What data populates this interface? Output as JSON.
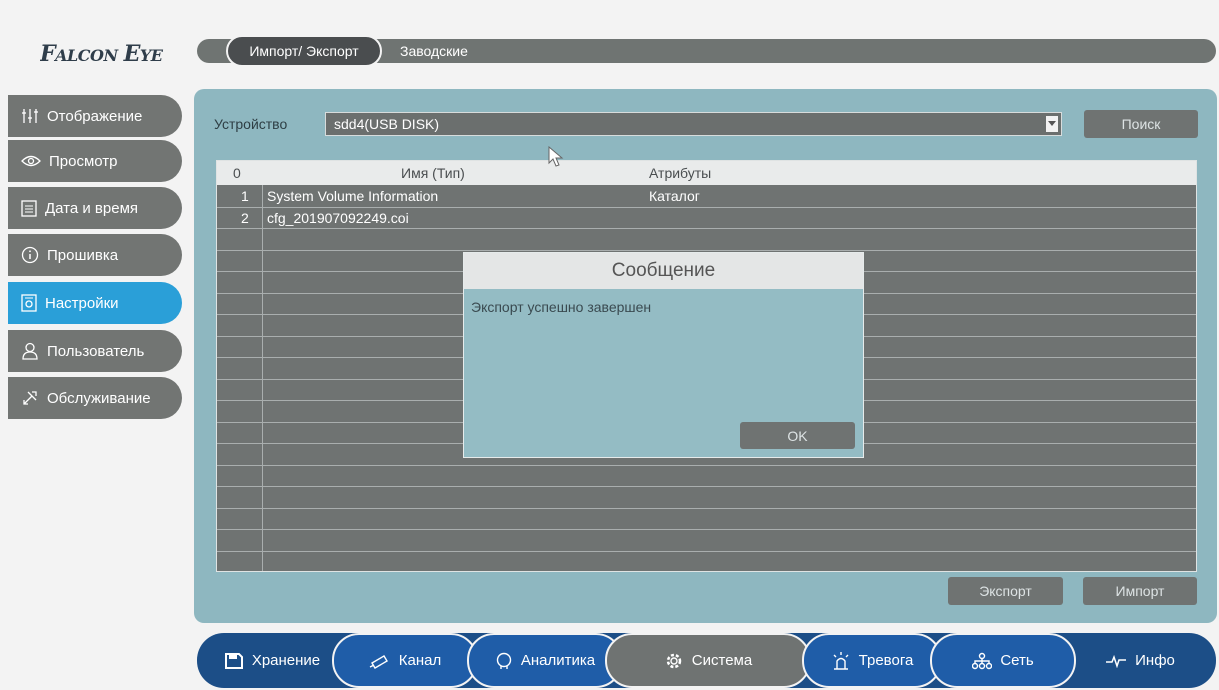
{
  "brand": {
    "logo_text": "Falcon Eye"
  },
  "tabs": [
    {
      "label": "Импорт/ Экспорт",
      "active": true
    },
    {
      "label": "Заводские",
      "active": false
    }
  ],
  "sidebar": {
    "items": [
      {
        "label": "Отображение",
        "icon": "sliders-icon"
      },
      {
        "label": "Просмотр",
        "icon": "eye-icon"
      },
      {
        "label": "Дата и время",
        "icon": "calendar-icon"
      },
      {
        "label": "Прошивка",
        "icon": "info-circle-icon"
      },
      {
        "label": "Настройки",
        "icon": "settings-file-icon",
        "active": true
      },
      {
        "label": "Пользователь",
        "icon": "user-icon"
      },
      {
        "label": "Обслуживание",
        "icon": "tools-icon"
      }
    ]
  },
  "device": {
    "label": "Устройство",
    "selected": "sdd4(USB DISK)",
    "search_button": "Поиск"
  },
  "file_table": {
    "headers": {
      "index": "0",
      "name": "Имя (Тип)",
      "attributes": "Атрибуты"
    },
    "rows": [
      {
        "index": "1",
        "name": "System Volume Information",
        "attributes": "Каталог"
      },
      {
        "index": "2",
        "name": "cfg_201907092249.coi",
        "attributes": ""
      }
    ]
  },
  "actions": {
    "export": "Экспорт",
    "import": "Импорт"
  },
  "dialog": {
    "title": "Сообщение",
    "message": "Экспорт успешно завершен",
    "ok": "OK"
  },
  "bottom_nav": [
    {
      "label": "Хранение",
      "icon": "save-icon"
    },
    {
      "label": "Канал",
      "icon": "camera-icon"
    },
    {
      "label": "Аналитика",
      "icon": "analytics-head-icon"
    },
    {
      "label": "Система",
      "icon": "gear-icon",
      "active": true
    },
    {
      "label": "Тревога",
      "icon": "alarm-icon"
    },
    {
      "label": "Сеть",
      "icon": "network-icon"
    },
    {
      "label": "Инфо",
      "icon": "pulse-icon"
    }
  ],
  "colors": {
    "accent": "#2a9fd8",
    "panel": "#8eb7c0",
    "nav_dark": "#1c4e87",
    "nav_blue": "#1f5da8",
    "gray": "#6f7372"
  }
}
